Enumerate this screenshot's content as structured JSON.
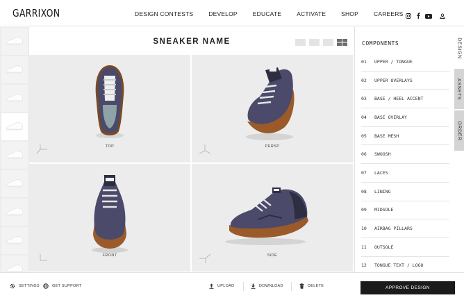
{
  "header": {
    "logo": "GARRIXON",
    "nav": [
      "DESIGN CONTESTS",
      "DEVELOP",
      "EDUCATE",
      "ACTIVATE",
      "SHOP",
      "CAREERS"
    ],
    "social_icons": [
      "instagram-icon",
      "facebook-icon",
      "youtube-icon",
      "account-icon"
    ]
  },
  "main": {
    "title": "SNEAKER NAME",
    "layout_options": [
      "single-view",
      "split-view",
      "compare-view",
      "grid-view"
    ],
    "active_layout": "grid-view",
    "views": [
      {
        "label": "TOP"
      },
      {
        "label": "PERSP"
      },
      {
        "label": "FRONT"
      },
      {
        "label": "SIDE"
      }
    ]
  },
  "thumbnails": {
    "count": 9,
    "active_index": 3
  },
  "panel": {
    "title": "COMPONENTS",
    "components": [
      {
        "num": "01",
        "label": "UPPER / TONGUE"
      },
      {
        "num": "02",
        "label": "UPPER OVERLAYS"
      },
      {
        "num": "03",
        "label": "BASE / HEEL ACCENT"
      },
      {
        "num": "04",
        "label": "BASE OVERLAY"
      },
      {
        "num": "05",
        "label": "BASE MESH"
      },
      {
        "num": "06",
        "label": "SWOOSH"
      },
      {
        "num": "07",
        "label": "LACES"
      },
      {
        "num": "08",
        "label": "LINING"
      },
      {
        "num": "09",
        "label": "MIDSOLE"
      },
      {
        "num": "10",
        "label": "AIRBAG PILLARS"
      },
      {
        "num": "11",
        "label": "OUTSOLE"
      },
      {
        "num": "12",
        "label": "TONGUE TEXT / LOGO"
      }
    ],
    "tabs": [
      "DESIGN",
      "ASSETS",
      "ORDER"
    ],
    "active_tab": "DESIGN"
  },
  "footer": {
    "settings": "SETTINGS",
    "support": "GET SUPPORT",
    "upload": "UPLOAD",
    "download": "DOWNLOAD",
    "delete": "DELETE",
    "approve": "APPROVE DESIGN"
  },
  "colors": {
    "upper": "#4b4a6a",
    "sole": "#9a5a2a",
    "accent": "#1b1b1b",
    "viewport_bg": "#ececec"
  }
}
